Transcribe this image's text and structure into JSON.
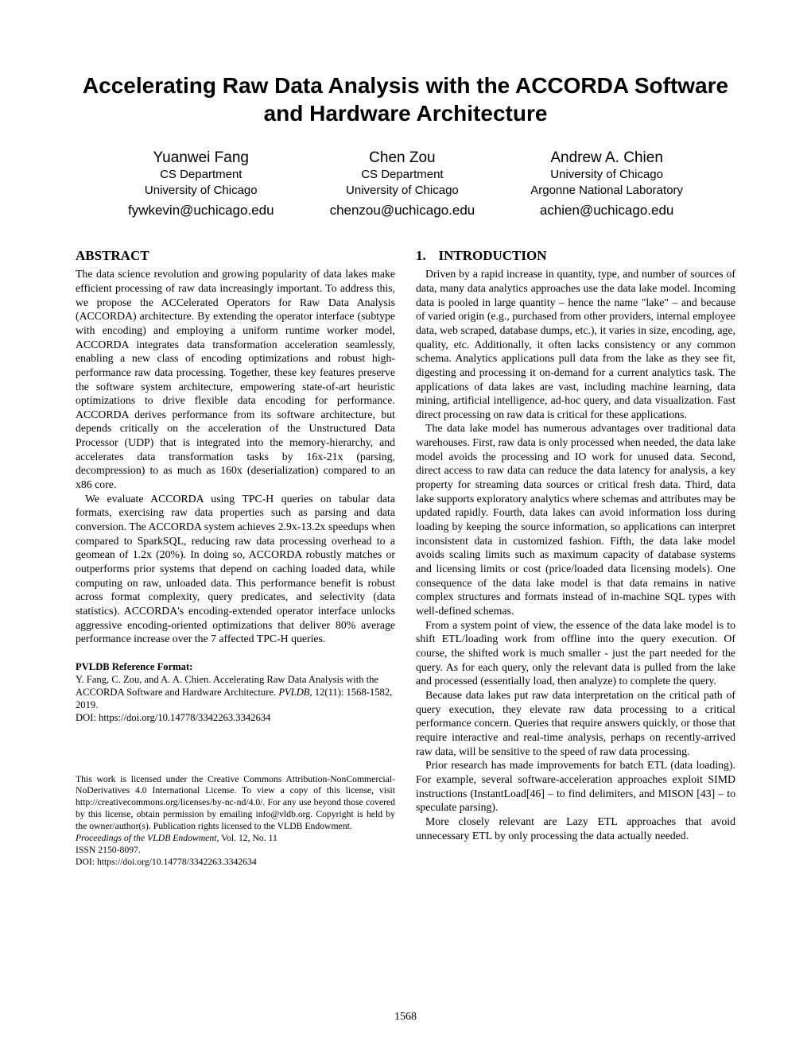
{
  "title": "Accelerating Raw Data Analysis with the ACCORDA Software and Hardware Architecture",
  "authors": [
    {
      "name": "Yuanwei Fang",
      "aff1": "CS Department",
      "aff2": "University of Chicago",
      "email": "fywkevin@uchicago.edu"
    },
    {
      "name": "Chen Zou",
      "aff1": "CS Department",
      "aff2": "University of Chicago",
      "email": "chenzou@uchicago.edu"
    },
    {
      "name": "Andrew A. Chien",
      "aff1": "University of Chicago",
      "aff2": "Argonne National Laboratory",
      "email": "achien@uchicago.edu"
    }
  ],
  "abstract_heading": "ABSTRACT",
  "abstract_p1": "The data science revolution and growing popularity of data lakes make efficient processing of raw data increasingly important. To address this, we propose the ACCelerated Operators for Raw Data Analysis (ACCORDA) architecture. By extending the operator interface (subtype with encoding) and employing a uniform runtime worker model, ACCORDA integrates data transformation acceleration seamlessly, enabling a new class of encoding optimizations and robust high-performance raw data processing. Together, these key features preserve the software system architecture, empowering state-of-art heuristic optimizations to drive flexible data encoding for performance. ACCORDA derives performance from its software architecture, but depends critically on the acceleration of the Unstructured Data Processor (UDP) that is integrated into the memory-hierarchy, and accelerates data transformation tasks by 16x-21x (parsing, decompression) to as much as 160x (deserialization) compared to an x86 core.",
  "abstract_p2": "We evaluate ACCORDA using TPC-H queries on tabular data formats, exercising raw data properties such as parsing and data conversion. The ACCORDA system achieves 2.9x-13.2x speedups when compared to SparkSQL, reducing raw data processing overhead to a geomean of 1.2x (20%). In doing so, ACCORDA robustly matches or outperforms prior systems that depend on caching loaded data, while computing on raw, unloaded data. This performance benefit is robust across format complexity, query predicates, and selectivity (data statistics). ACCORDA's encoding-extended operator interface unlocks aggressive encoding-oriented optimizations that deliver 80% average performance increase over the 7 affected TPC-H queries.",
  "ref_format_hdr": "PVLDB Reference Format:",
  "ref_format_authors": "Y. Fang, C. Zou, and A. A. Chien. Accelerating Raw Data Analysis with the ACCORDA Software and Hardware Architecture. ",
  "ref_format_journal": "PVLDB",
  "ref_format_vol": ", 12(11): 1568-1582, 2019.",
  "ref_format_doi": "DOI: https://doi.org/10.14778/3342263.3342634",
  "license_p1": "This work is licensed under the Creative Commons Attribution-NonCommercial-NoDerivatives 4.0 International License. To view a copy of this license, visit http://creativecommons.org/licenses/by-nc-nd/4.0/. For any use beyond those covered by this license, obtain permission by emailing info@vldb.org. Copyright is held by the owner/author(s). Publication rights licensed to the VLDB Endowment.",
  "license_proc": "Proceedings of the VLDB Endowment,",
  "license_vol": " Vol. 12, No. 11",
  "license_issn": "ISSN 2150-8097.",
  "license_doi": "DOI: https://doi.org/10.14778/3342263.3342634",
  "intro_heading_num": "1.",
  "intro_heading": "INTRODUCTION",
  "intro_p1": "Driven by a rapid increase in quantity, type, and number of sources of data, many data analytics approaches use the data lake model. Incoming data is pooled in large quantity – hence the name \"lake\" – and because of varied origin (e.g., purchased from other providers, internal employee data, web scraped, database dumps, etc.), it varies in size, encoding, age, quality, etc. Additionally, it often lacks consistency or any common schema. Analytics applications pull data from the lake as they see fit, digesting and processing it on-demand for a current analytics task. The applications of data lakes are vast, including machine learning, data mining, artificial intelligence, ad-hoc query, and data visualization. Fast direct processing on raw data is critical for these applications.",
  "intro_p2": "The data lake model has numerous advantages over traditional data warehouses. First, raw data is only processed when needed, the data lake model avoids the processing and IO work for unused data. Second, direct access to raw data can reduce the data latency for analysis, a key property for streaming data sources or critical fresh data. Third, data lake supports exploratory analytics where schemas and attributes may be updated rapidly. Fourth, data lakes can avoid information loss during loading by keeping the source information, so applications can interpret inconsistent data in customized fashion. Fifth, the data lake model avoids scaling limits such as maximum capacity of database systems and licensing limits or cost (price/loaded data licensing models). One consequence of the data lake model is that data remains in native complex structures and formats instead of in-machine SQL types with well-defined schemas.",
  "intro_p3": "From a system point of view, the essence of the data lake model is to shift ETL/loading work from offline into the query execution. Of course, the shifted work is much smaller - just the part needed for the query. As for each query, only the relevant data is pulled from the lake and processed (essentially load, then analyze) to complete the query.",
  "intro_p4": "Because data lakes put raw data interpretation on the critical path of query execution, they elevate raw data processing to a critical performance concern. Queries that require answers quickly, or those that require interactive and real-time analysis, perhaps on recently-arrived raw data, will be sensitive to the speed of raw data processing.",
  "intro_p5": "Prior research has made improvements for batch ETL (data loading). For example, several software-acceleration approaches exploit SIMD instructions (InstantLoad[46] – to find delimiters, and MISON [43] – to speculate parsing).",
  "intro_p6": "More closely relevant are Lazy ETL approaches that avoid unnecessary ETL by only processing the data actually needed.",
  "page_number": "1568"
}
